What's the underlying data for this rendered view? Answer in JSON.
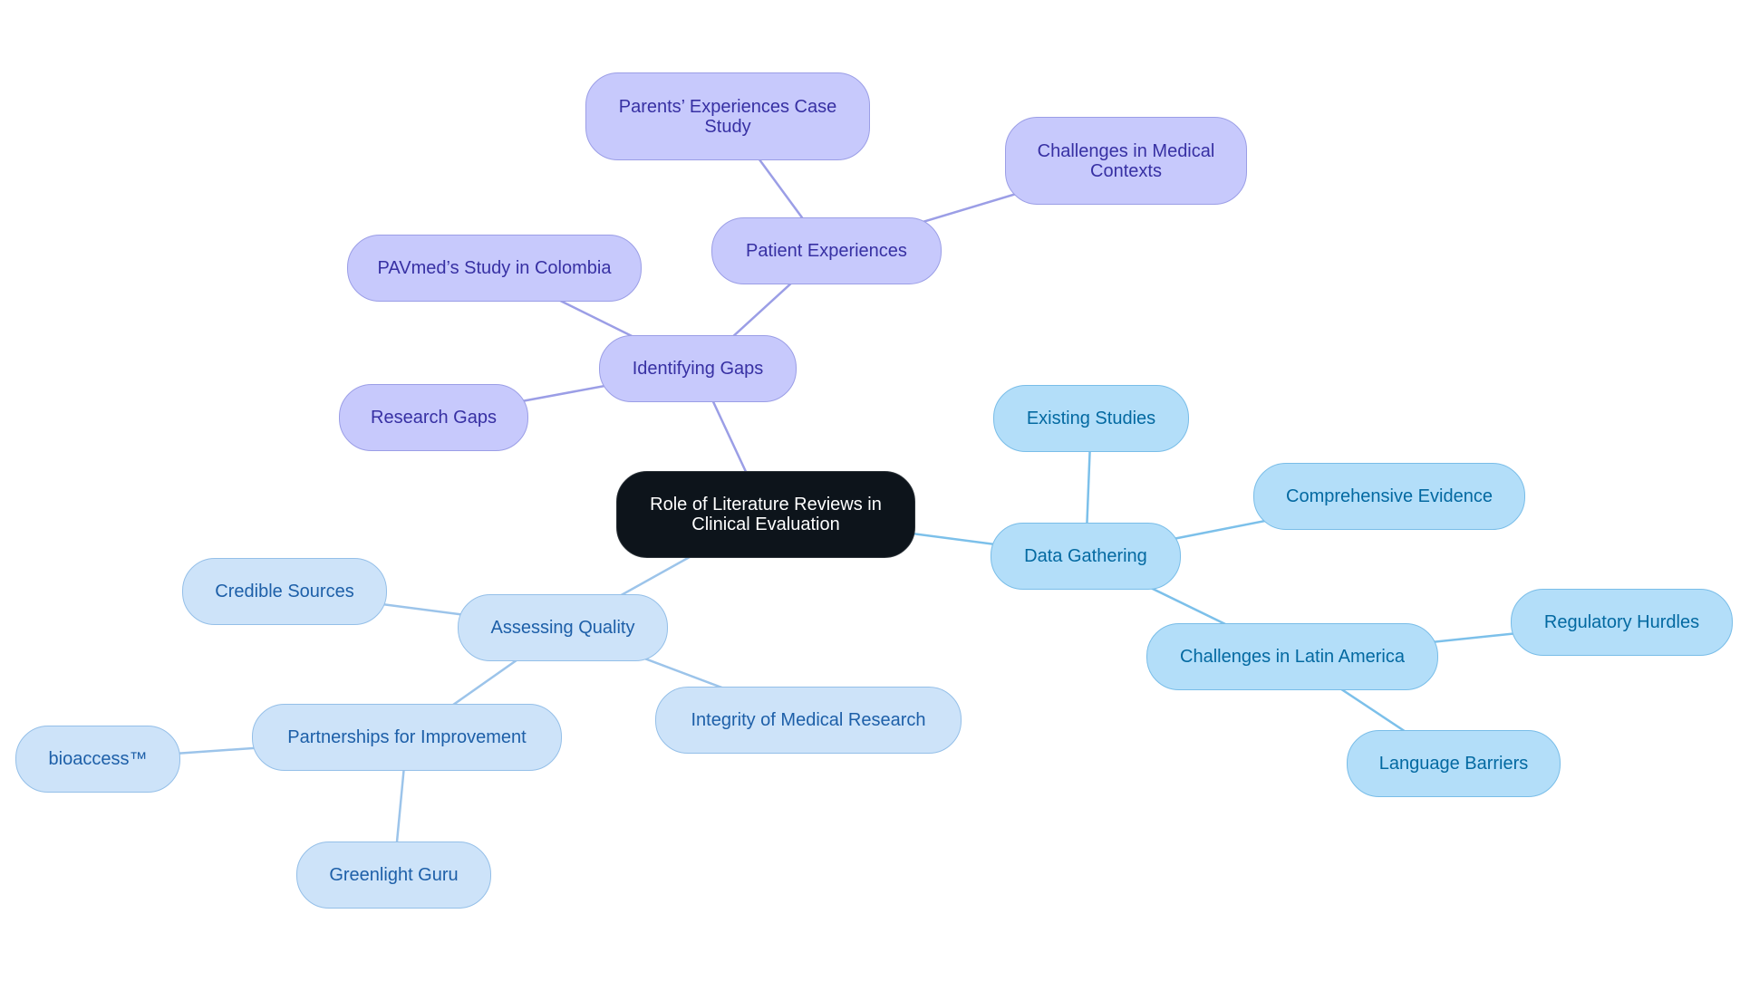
{
  "diagram": {
    "title": "Role of Literature Reviews in Clinical Evaluation",
    "colors": {
      "purple_edge": "#9b9ee6",
      "sky_edge": "#7cc0ea",
      "pale_edge": "#9cc4ea"
    },
    "nodes": {
      "root": "Role of Literature Reviews in Clinical Evaluation",
      "identifying_gaps": "Identifying Gaps",
      "patient_experiences": "Patient Experiences",
      "parents_case_study": "Parents’ Experiences Case Study",
      "challenges_medical": "Challenges in Medical Contexts",
      "pavmed_study": "PAVmed’s Study in Colombia",
      "research_gaps": "Research Gaps",
      "data_gathering": "Data Gathering",
      "existing_studies": "Existing Studies",
      "comprehensive_evidence": "Comprehensive Evidence",
      "challenges_latam": "Challenges in Latin America",
      "regulatory_hurdles": "Regulatory Hurdles",
      "language_barriers": "Language Barriers",
      "assessing_quality": "Assessing Quality",
      "credible_sources": "Credible Sources",
      "integrity_research": "Integrity of Medical Research",
      "partnerships": "Partnerships for Improvement",
      "bioaccess": "bioaccess™",
      "greenlight_guru": "Greenlight Guru"
    },
    "edges": [
      {
        "from": "root",
        "to": "identifying_gaps",
        "branch": "purple"
      },
      {
        "from": "identifying_gaps",
        "to": "patient_experiences",
        "branch": "purple"
      },
      {
        "from": "patient_experiences",
        "to": "parents_case_study",
        "branch": "purple"
      },
      {
        "from": "patient_experiences",
        "to": "challenges_medical",
        "branch": "purple"
      },
      {
        "from": "identifying_gaps",
        "to": "pavmed_study",
        "branch": "purple"
      },
      {
        "from": "identifying_gaps",
        "to": "research_gaps",
        "branch": "purple"
      },
      {
        "from": "root",
        "to": "data_gathering",
        "branch": "sky"
      },
      {
        "from": "data_gathering",
        "to": "existing_studies",
        "branch": "sky"
      },
      {
        "from": "data_gathering",
        "to": "comprehensive_evidence",
        "branch": "sky"
      },
      {
        "from": "data_gathering",
        "to": "challenges_latam",
        "branch": "sky"
      },
      {
        "from": "challenges_latam",
        "to": "regulatory_hurdles",
        "branch": "sky"
      },
      {
        "from": "challenges_latam",
        "to": "language_barriers",
        "branch": "sky"
      },
      {
        "from": "root",
        "to": "assessing_quality",
        "branch": "pale"
      },
      {
        "from": "assessing_quality",
        "to": "credible_sources",
        "branch": "pale"
      },
      {
        "from": "assessing_quality",
        "to": "integrity_research",
        "branch": "pale"
      },
      {
        "from": "assessing_quality",
        "to": "partnerships",
        "branch": "pale"
      },
      {
        "from": "partnerships",
        "to": "bioaccess",
        "branch": "pale"
      },
      {
        "from": "partnerships",
        "to": "greenlight_guru",
        "branch": "pale"
      }
    ]
  }
}
